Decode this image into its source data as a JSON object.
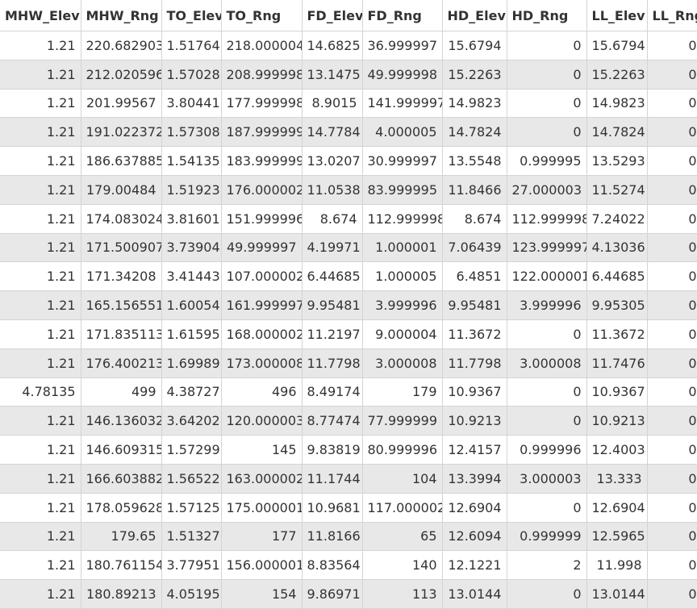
{
  "table": {
    "columns": [
      "MHW_Elev",
      "MHW_Rng",
      "TO_Elev",
      "TO_Rng",
      "FD_Elev",
      "FD_Rng",
      "HD_Elev",
      "HD_Rng",
      "LL_Elev",
      "LL_Rng"
    ],
    "rows": [
      [
        "1.21",
        "220.682903",
        "1.51764",
        "218.000004",
        "14.6825",
        "36.999997",
        "15.6794",
        "0",
        "15.6794",
        "0"
      ],
      [
        "1.21",
        "212.020596",
        "1.57028",
        "208.999998",
        "13.1475",
        "49.999998",
        "15.2263",
        "0",
        "15.2263",
        "0"
      ],
      [
        "1.21",
        "201.99567",
        "3.80441",
        "177.999998",
        "8.9015",
        "141.999997",
        "14.9823",
        "0",
        "14.9823",
        "0"
      ],
      [
        "1.21",
        "191.022372",
        "1.57308",
        "187.999999",
        "14.7784",
        "4.000005",
        "14.7824",
        "0",
        "14.7824",
        "0"
      ],
      [
        "1.21",
        "186.637885",
        "1.54135",
        "183.999999",
        "13.0207",
        "30.999997",
        "13.5548",
        "0.999995",
        "13.5293",
        "0"
      ],
      [
        "1.21",
        "179.00484",
        "1.51923",
        "176.000002",
        "11.0538",
        "83.999995",
        "11.8466",
        "27.000003",
        "11.5274",
        "0"
      ],
      [
        "1.21",
        "174.083024",
        "3.81601",
        "151.999996",
        "8.674",
        "112.999998",
        "8.674",
        "112.999998",
        "7.24022",
        "0"
      ],
      [
        "1.21",
        "171.500907",
        "3.73904",
        "49.999997",
        "4.19971",
        "1.000001",
        "7.06439",
        "123.999997",
        "4.13036",
        "0"
      ],
      [
        "1.21",
        "171.34208",
        "3.41443",
        "107.000002",
        "6.44685",
        "1.000005",
        "6.4851",
        "122.000001",
        "6.44685",
        "0"
      ],
      [
        "1.21",
        "165.156551",
        "1.60054",
        "161.999997",
        "9.95481",
        "3.999996",
        "9.95481",
        "3.999996",
        "9.95305",
        "0"
      ],
      [
        "1.21",
        "171.835113",
        "1.61595",
        "168.000002",
        "11.2197",
        "9.000004",
        "11.3672",
        "0",
        "11.3672",
        "0"
      ],
      [
        "1.21",
        "176.400213",
        "1.69989",
        "173.000008",
        "11.7798",
        "3.000008",
        "11.7798",
        "3.000008",
        "11.7476",
        "0"
      ],
      [
        "4.78135",
        "499",
        "4.38727",
        "496",
        "8.49174",
        "179",
        "10.9367",
        "0",
        "10.9367",
        "0"
      ],
      [
        "1.21",
        "146.136032",
        "3.64202",
        "120.000003",
        "8.77474",
        "77.999999",
        "10.9213",
        "0",
        "10.9213",
        "0"
      ],
      [
        "1.21",
        "146.609315",
        "1.57299",
        "145",
        "9.83819",
        "80.999996",
        "12.4157",
        "0.999996",
        "12.4003",
        "0"
      ],
      [
        "1.21",
        "166.603882",
        "1.56522",
        "163.000002",
        "11.1744",
        "104",
        "13.3994",
        "3.000003",
        "13.333",
        "0"
      ],
      [
        "1.21",
        "178.059628",
        "1.57125",
        "175.000001",
        "10.9681",
        "117.000002",
        "12.6904",
        "0",
        "12.6904",
        "0"
      ],
      [
        "1.21",
        "179.65",
        "1.51327",
        "177",
        "11.8166",
        "65",
        "12.6094",
        "0.999999",
        "12.5965",
        "0"
      ],
      [
        "1.21",
        "180.761154",
        "3.77951",
        "156.000001",
        "8.83564",
        "140",
        "12.1221",
        "2",
        "11.998",
        "0"
      ],
      [
        "1.21",
        "180.89213",
        "4.05195",
        "154",
        "9.86971",
        "113",
        "13.0144",
        "0",
        "13.0144",
        "0"
      ]
    ]
  },
  "colors": {
    "header_bg": "#ffffff",
    "row_even_bg": "#ffffff",
    "row_odd_bg": "#e8e8e8",
    "grid_line": "#d4d4d4",
    "text": "#333333"
  }
}
